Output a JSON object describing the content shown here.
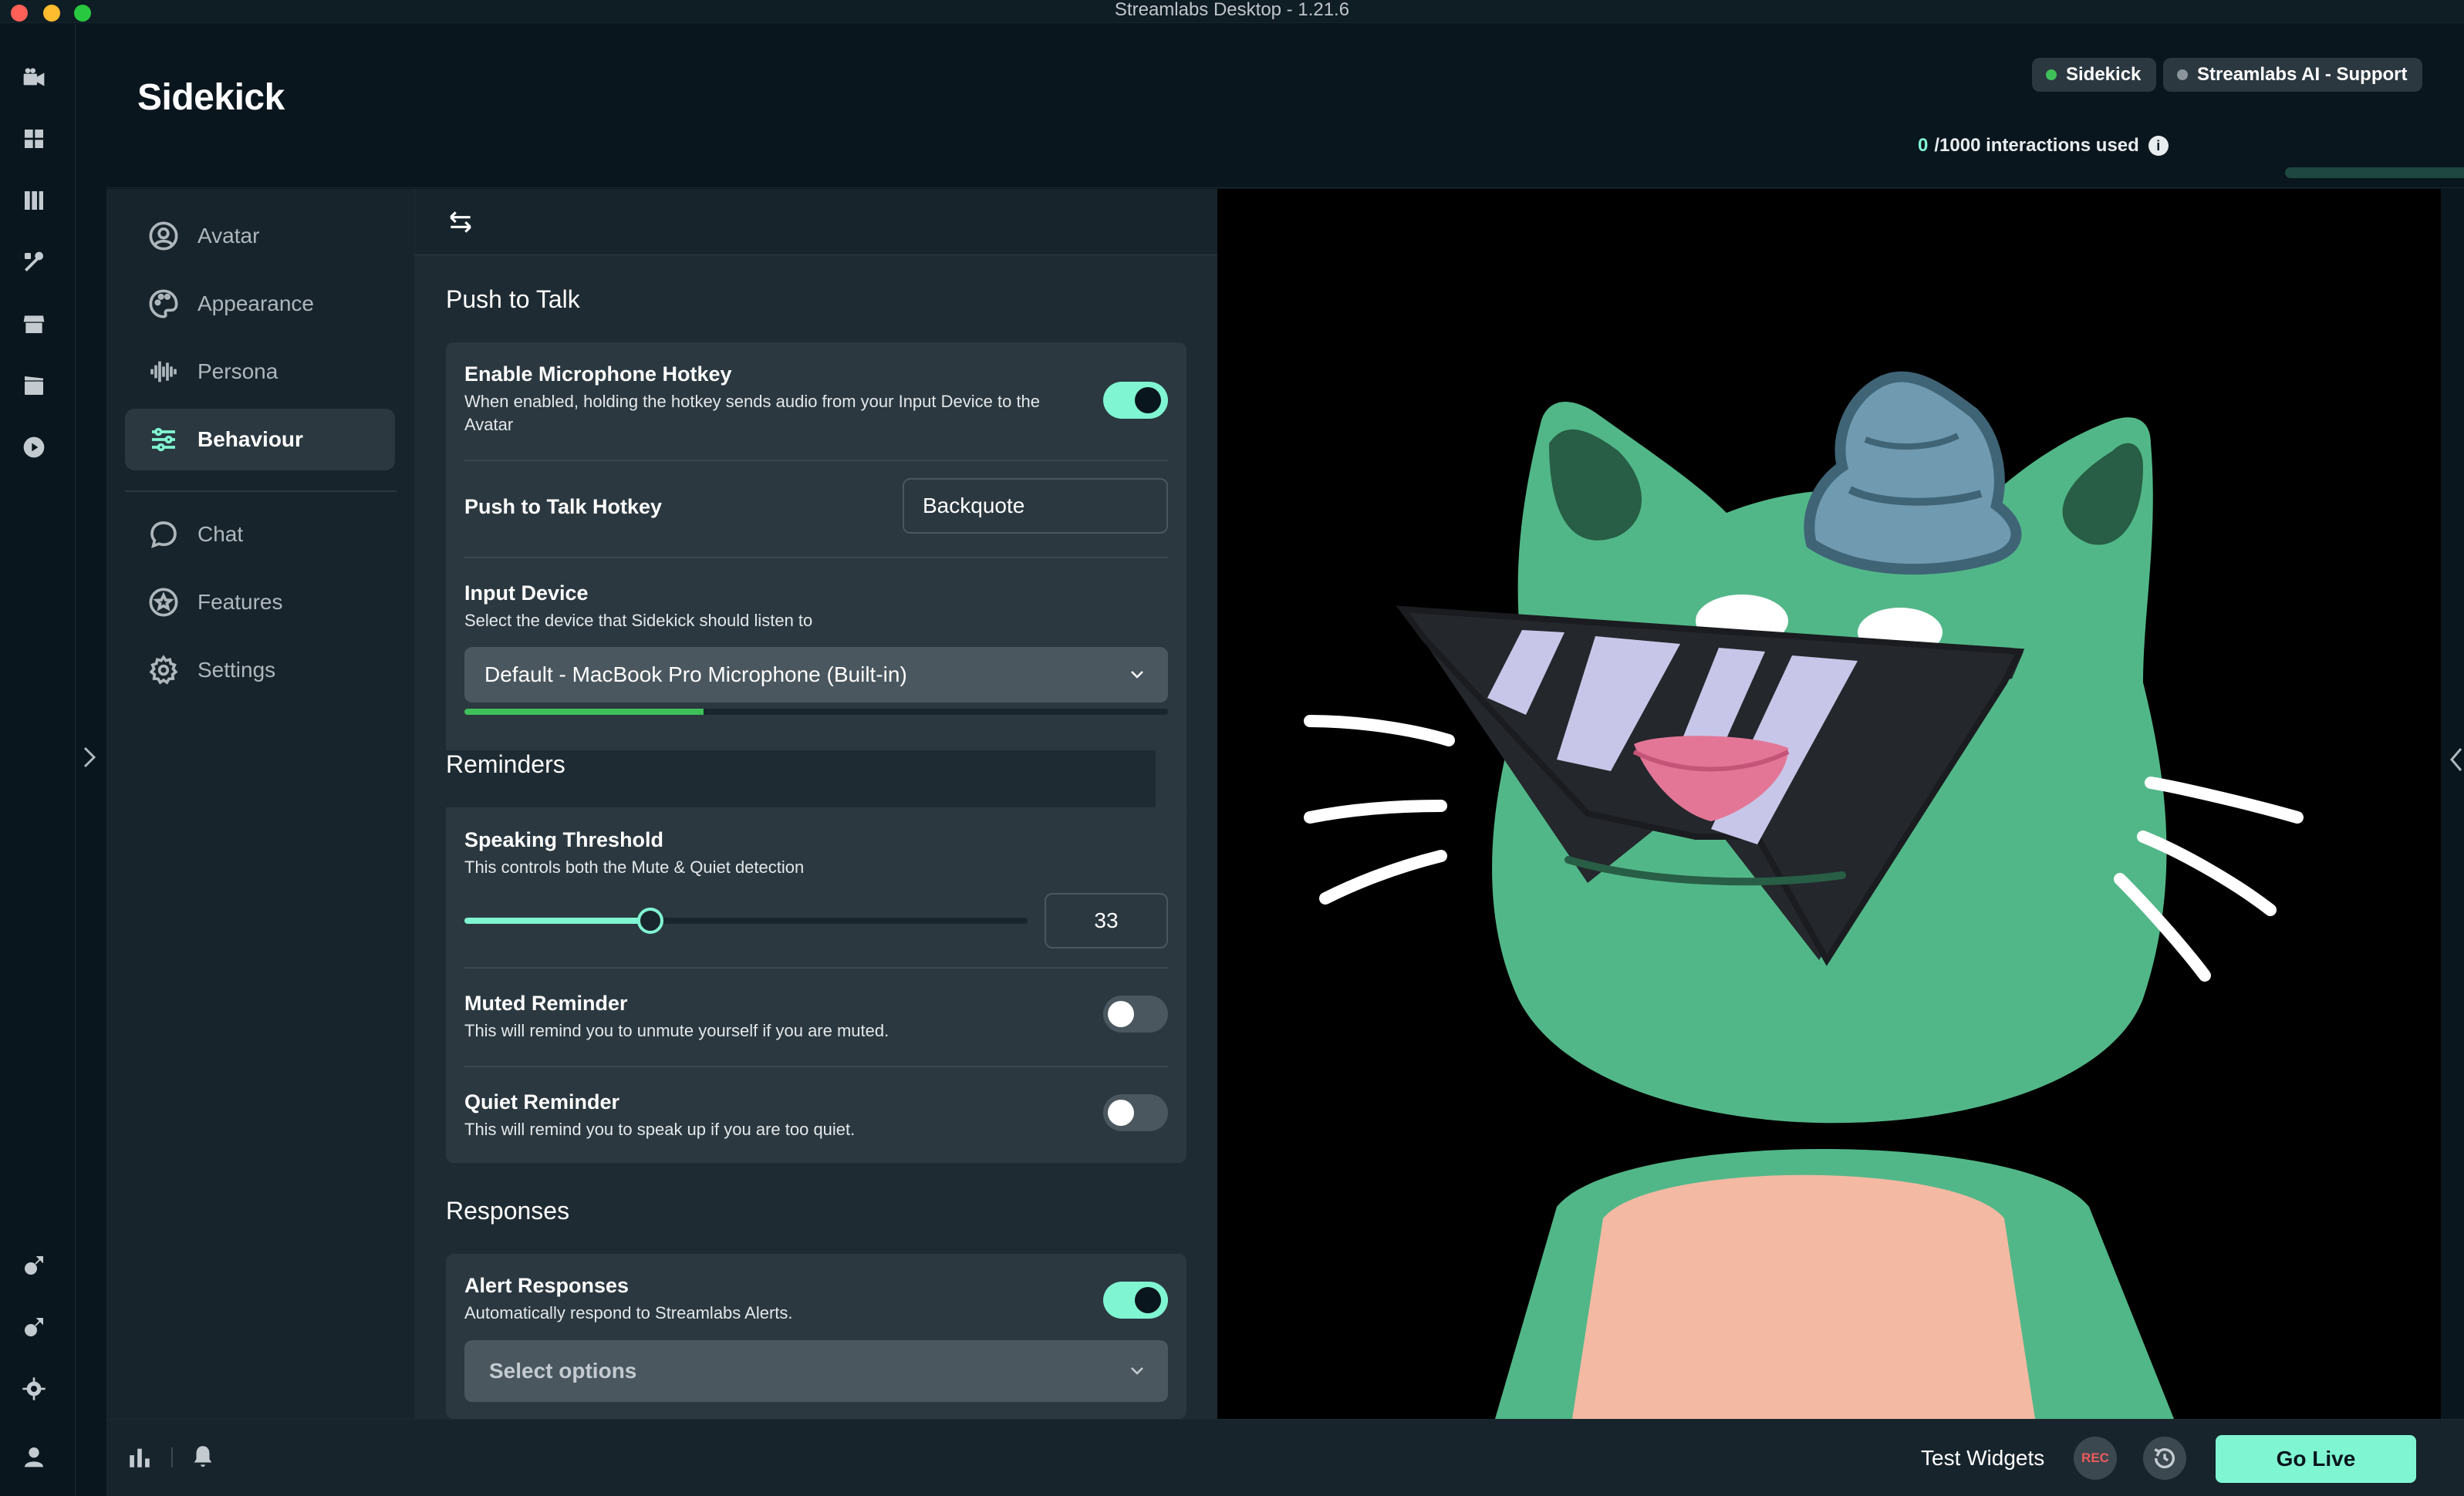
{
  "window": {
    "title": "Streamlabs Desktop - 1.21.6"
  },
  "header": {
    "title": "Sidekick",
    "pills": [
      {
        "label": "Sidekick",
        "status": "active",
        "dot_color": "#3fbf5a"
      },
      {
        "label": "Streamlabs AI - Support",
        "status": "inactive",
        "dot_color": "#8a949a"
      }
    ],
    "usage": {
      "used": "0",
      "rest": "/1000 interactions used",
      "fraction": 0.0
    }
  },
  "rail": {
    "top_icons": [
      "video-camera-icon",
      "dashboard-icon",
      "library-icon",
      "tools-icon",
      "store-icon",
      "editor-icon",
      "play-icon"
    ],
    "bottom_icons": [
      "app-link-icon",
      "app-link-2-icon",
      "settings-gear-icon",
      "user-icon"
    ]
  },
  "nav": {
    "items": [
      {
        "label": "Avatar",
        "icon": "user-circle-icon",
        "active": false
      },
      {
        "label": "Appearance",
        "icon": "palette-icon",
        "active": false
      },
      {
        "label": "Persona",
        "icon": "waveform-icon",
        "active": false
      },
      {
        "label": "Behaviour",
        "icon": "sliders-icon",
        "active": true
      },
      {
        "label": "Chat",
        "icon": "chat-bubble-icon",
        "active": false
      },
      {
        "label": "Features",
        "icon": "star-badge-icon",
        "active": false
      },
      {
        "label": "Settings",
        "icon": "gear-icon",
        "active": false
      }
    ]
  },
  "push_to_talk": {
    "section_title": "Push to Talk",
    "enable_hotkey": {
      "title": "Enable Microphone Hotkey",
      "desc_line1": "When enabled, holding the hotkey sends audio from your Input Device to the",
      "desc_line2": "Avatar",
      "on": true
    },
    "hotkey": {
      "title": "Push to Talk Hotkey",
      "value": "Backquote"
    },
    "input_device": {
      "title": "Input Device",
      "desc": "Select the device that Sidekick should listen to",
      "selected": "Default - MacBook Pro Microphone (Built-in)",
      "level": 0.34
    }
  },
  "reminders": {
    "section_title": "Reminders",
    "threshold": {
      "title": "Speaking Threshold",
      "desc": "This controls both the Mute & Quiet detection",
      "value": "33",
      "fraction": 0.33
    },
    "muted": {
      "title": "Muted Reminder",
      "desc": "This will remind you to unmute yourself if you are muted.",
      "on": false
    },
    "quiet": {
      "title": "Quiet Reminder",
      "desc": "This will remind you to speak up if you are too quiet.",
      "on": false
    }
  },
  "responses": {
    "section_title": "Responses",
    "alert": {
      "title": "Alert Responses",
      "desc": "Automatically respond to Streamlabs Alerts.",
      "on": true,
      "placeholder": "Select options"
    }
  },
  "footer": {
    "test_widgets": "Test Widgets",
    "rec": "REC",
    "go_live": "Go Live"
  },
  "colors": {
    "accent": "#80f5d2",
    "background": "#09161d",
    "panel": "#1f2b33",
    "card": "#2b3840",
    "avatar_green": "#52b788"
  }
}
